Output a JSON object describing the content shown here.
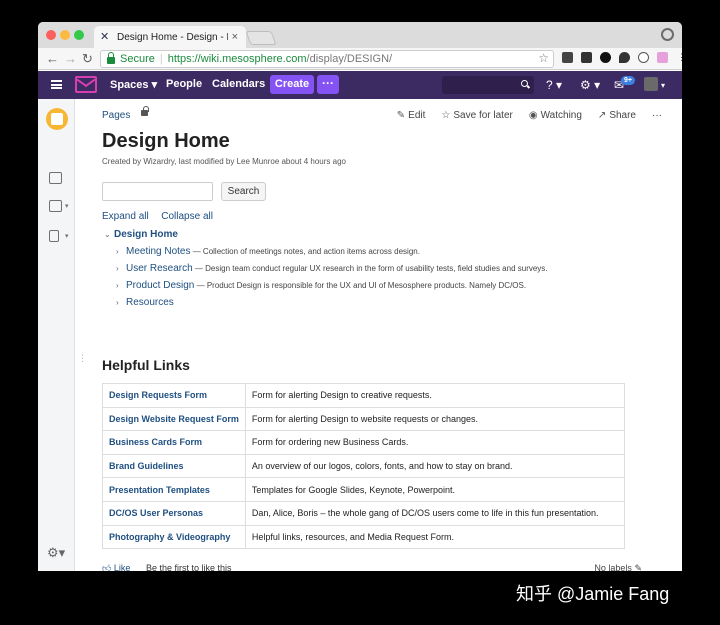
{
  "browser": {
    "tab_title": "Design Home - Design - Meso",
    "tab_close": "×",
    "secure_label": "Secure",
    "url_prefix": "https://",
    "url_host": "wiki.mesosphere.com",
    "url_path": "/display/DESIGN/",
    "star": "☆"
  },
  "header": {
    "nav": [
      "Spaces",
      "People",
      "Calendars"
    ],
    "create_label": "Create",
    "more_label": "···",
    "notification_count": "9+"
  },
  "page": {
    "breadcrumb": "Pages",
    "actions": {
      "edit": "Edit",
      "save_for_later": "Save for later",
      "watching": "Watching",
      "share": "Share",
      "more": "···"
    },
    "title": "Design Home",
    "byline": "Created by Wizardry, last modified by Lee Munroe about 4 hours ago",
    "search_button": "Search",
    "expand_all": "Expand all",
    "collapse_all": "Collapse all",
    "tree": {
      "root": "Design Home",
      "children": [
        {
          "name": "Meeting Notes",
          "desc": " — Collection of meetings notes, and action items across design."
        },
        {
          "name": "User Research",
          "desc": " — Design team conduct regular UX research in the form of usability tests, field studies and surveys."
        },
        {
          "name": "Product Design",
          "desc": " — Product Design is responsible for the UX and UI of Mesosphere products. Namely DC/OS."
        },
        {
          "name": "Resources",
          "desc": ""
        }
      ]
    },
    "helpful_links_title": "Helpful Links",
    "links": [
      {
        "name": "Design Requests Form",
        "desc": "Form for alerting Design to creative requests."
      },
      {
        "name": "Design Website Request Form",
        "desc": "Form for alerting Design to website requests or changes."
      },
      {
        "name": "Business Cards Form",
        "desc": "Form for ordering new Business Cards."
      },
      {
        "name": "Brand Guidelines",
        "desc": "An overview of our logos, colors, fonts, and how to stay on brand."
      },
      {
        "name": "Presentation Templates",
        "desc": "Templates for Google Slides, Keynote, Powerpoint."
      },
      {
        "name": "DC/OS User Personas",
        "desc": "Dan, Alice, Boris – the whole gang of DC/OS users come to life in this fun presentation."
      },
      {
        "name": "Photography & Videography",
        "desc": "Helpful links, resources, and Media Request Form."
      }
    ],
    "like_label": "Like",
    "first_to_like": "Be the first to like this",
    "no_labels": "No labels"
  },
  "watermark": "知乎 @Jamie Fang"
}
